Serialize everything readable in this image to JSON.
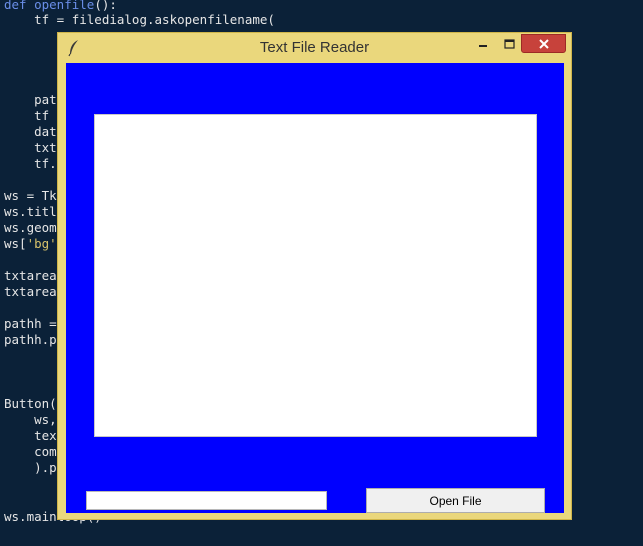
{
  "code": {
    "line1_kw": "def",
    "line1_name": " openfile",
    "line1_rest": "():",
    "line2": "    tf = filedialog.askopenfilename(",
    "line3": "    pat",
    "line4": "    tf",
    "line5": "    dat",
    "line6": "    txt",
    "line7": "    tf.",
    "line8": "ws = Tk",
    "line9": "ws.titl",
    "line10": "ws.geom",
    "line11_pre": "ws[",
    "line11_str": "'bg'",
    "line11_post": "]",
    "line12": "txtarea",
    "line13": "txtarea",
    "line14": "pathh =",
    "line15": "pathh.p",
    "line16": "Button(",
    "line17": "    ws,",
    "line18": "    tex",
    "line19": "    com",
    "line20": "    ).p",
    "line21": "ws.mainloop()"
  },
  "window": {
    "title": "Text File Reader",
    "accent_color": "#ead77c",
    "close_color": "#c7423b",
    "background_color": "#0000ff"
  },
  "text_area": {
    "content": ""
  },
  "path_entry": {
    "value": ""
  },
  "open_button": {
    "label": "Open File"
  }
}
